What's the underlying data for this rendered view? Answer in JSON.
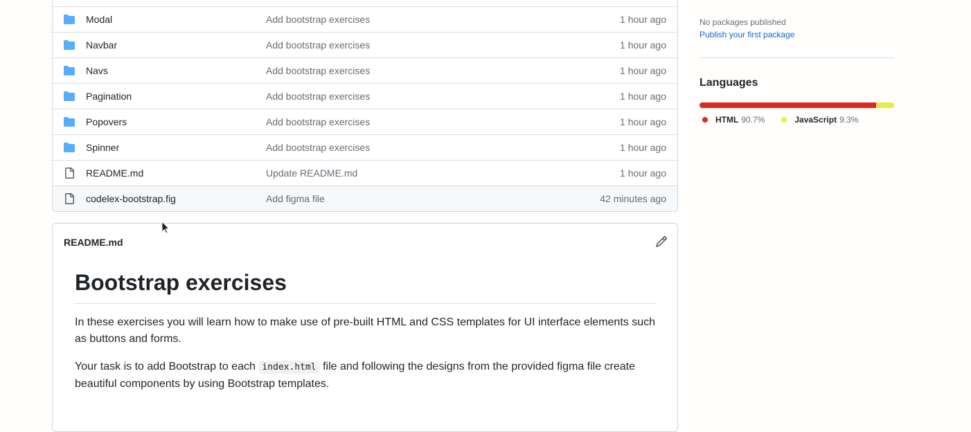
{
  "file_list": {
    "rows": [
      {
        "name": "Modal",
        "type": "folder",
        "commit": "Add bootstrap exercises",
        "age": "1 hour ago"
      },
      {
        "name": "Navbar",
        "type": "folder",
        "commit": "Add bootstrap exercises",
        "age": "1 hour ago"
      },
      {
        "name": "Navs",
        "type": "folder",
        "commit": "Add bootstrap exercises",
        "age": "1 hour ago"
      },
      {
        "name": "Pagination",
        "type": "folder",
        "commit": "Add bootstrap exercises",
        "age": "1 hour ago"
      },
      {
        "name": "Popovers",
        "type": "folder",
        "commit": "Add bootstrap exercises",
        "age": "1 hour ago"
      },
      {
        "name": "Spinner",
        "type": "folder",
        "commit": "Add bootstrap exercises",
        "age": "1 hour ago"
      },
      {
        "name": "README.md",
        "type": "file",
        "commit": "Update README.md",
        "age": "1 hour ago"
      },
      {
        "name": "codelex-bootstrap.fig",
        "type": "file",
        "commit": "Add figma file",
        "age": "42 minutes ago"
      }
    ]
  },
  "readme": {
    "filename": "README.md",
    "heading": "Bootstrap exercises",
    "para1": "In these exercises you will learn how to make use of pre-built HTML and CSS templates for UI interface elements such as buttons and forms.",
    "para2_before": "Your task is to add Bootstrap to each ",
    "para2_code": "index.html",
    "para2_after": " file and following the designs from the provided figma file create beautiful components by using Bootstrap templates.",
    "edit_icon": "pencil-icon"
  },
  "sidebar": {
    "packages_none": "No packages published",
    "packages_link": "Publish your first package",
    "languages_title": "Languages",
    "languages": [
      {
        "name": "HTML",
        "percent_label": "90.7%",
        "percent": 90.7,
        "color": "#e34c26"
      },
      {
        "name": "JavaScript",
        "percent_label": "9.3%",
        "percent": 9.3,
        "color": "#f1e05a"
      }
    ]
  },
  "colors": {
    "folder": "#54aeff",
    "link": "#0969da",
    "html_bar": "#d22d1e",
    "js_bar": "#e8e94e"
  }
}
